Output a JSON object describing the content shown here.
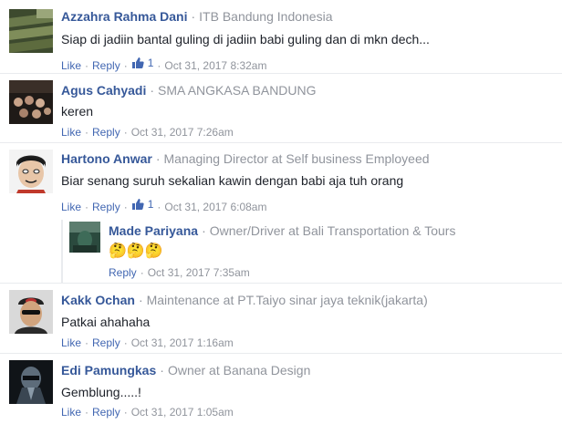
{
  "labels": {
    "like": "Like",
    "reply": "Reply",
    "sep": "·"
  },
  "comments": [
    {
      "author": "Azzahra Rahma Dani",
      "title": "ITB Bandung Indonesia",
      "text": "Siap di jadiin bantal guling di jadiin babi guling dan di mkn dech...",
      "likes": "1",
      "time": "Oct 31, 2017 8:32am"
    },
    {
      "author": "Agus Cahyadi",
      "title": "SMA ANGKASA BANDUNG",
      "text": "keren",
      "time": "Oct 31, 2017 7:26am"
    },
    {
      "author": "Hartono Anwar",
      "title": "Managing Director at Self business Employeed",
      "text": "Biar senang suruh sekalian kawin dengan babi aja tuh orang",
      "likes": "1",
      "time": "Oct 31, 2017 6:08am"
    },
    {
      "author": "Kakk Ochan",
      "title": "Maintenance at PT.Taiyo sinar jaya teknik(jakarta)",
      "text": "Patkai ahahaha",
      "time": "Oct 31, 2017 1:16am"
    },
    {
      "author": "Edi Pamungkas",
      "title": "Owner at Banana Design",
      "text": "Gemblung.....!",
      "time": "Oct 31, 2017 1:05am"
    }
  ],
  "reply": {
    "author": "Made Pariyana",
    "title": "Owner/Driver at Bali Transportation & Tours",
    "text": "🤔🤔🤔",
    "time": "Oct 31, 2017 7:35am"
  },
  "colors": {
    "author_link": "#365899",
    "action_link": "#4267b2",
    "muted": "#90949c",
    "text": "#1d2129",
    "like_badge": "#4267b2"
  }
}
